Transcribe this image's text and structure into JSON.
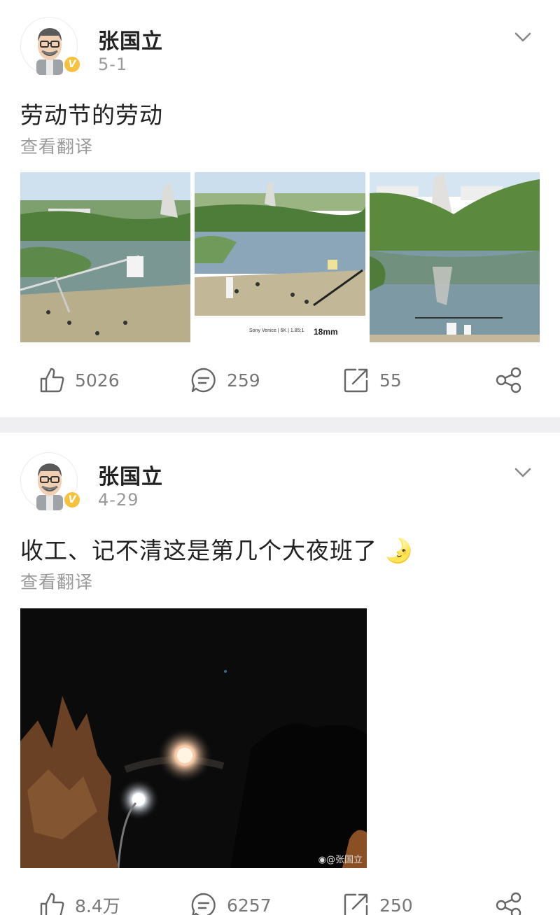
{
  "posts": [
    {
      "username": "张国立",
      "date": "5-1",
      "text": "劳动节的劳动",
      "translate_label": "查看翻译",
      "photos": [
        {
          "name": "film-set-lake-photo-1"
        },
        {
          "name": "film-set-lake-photo-2",
          "caption": "Sony Venice | 6K | 1.85:1",
          "lens": "18mm"
        },
        {
          "name": "film-set-lake-photo-3"
        }
      ],
      "likes": "5026",
      "comments": "259",
      "reposts": "55"
    },
    {
      "username": "张国立",
      "date": "4-29",
      "text": "收工、记不清这是第几个大夜班了",
      "emoji": "🌛",
      "translate_label": "查看翻译",
      "photos": [
        {
          "name": "night-moon-photo",
          "watermark": "@张国立"
        }
      ],
      "likes": "8.4万",
      "comments": "6257",
      "reposts": "250"
    }
  ],
  "colors": {
    "verified_badge": "#f6c23e",
    "divider": "#efeff1",
    "muted_text": "#9a9a9a"
  }
}
